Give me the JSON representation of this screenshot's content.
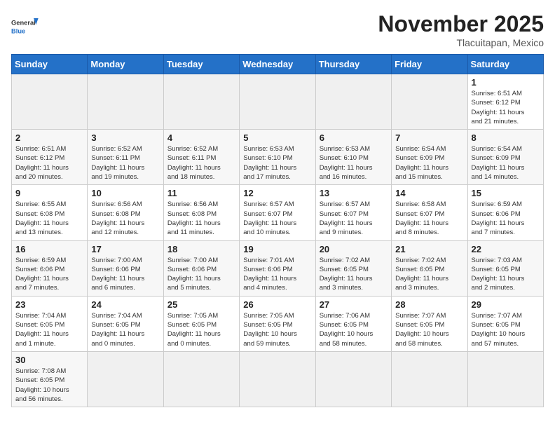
{
  "header": {
    "logo_general": "General",
    "logo_blue": "Blue",
    "month_year": "November 2025",
    "location": "Tlacuitapan, Mexico"
  },
  "weekdays": [
    "Sunday",
    "Monday",
    "Tuesday",
    "Wednesday",
    "Thursday",
    "Friday",
    "Saturday"
  ],
  "weeks": [
    [
      {
        "day": "",
        "info": ""
      },
      {
        "day": "",
        "info": ""
      },
      {
        "day": "",
        "info": ""
      },
      {
        "day": "",
        "info": ""
      },
      {
        "day": "",
        "info": ""
      },
      {
        "day": "",
        "info": ""
      },
      {
        "day": "1",
        "info": "Sunrise: 6:51 AM\nSunset: 6:12 PM\nDaylight: 11 hours\nand 21 minutes."
      }
    ],
    [
      {
        "day": "2",
        "info": "Sunrise: 6:51 AM\nSunset: 6:12 PM\nDaylight: 11 hours\nand 20 minutes."
      },
      {
        "day": "3",
        "info": "Sunrise: 6:52 AM\nSunset: 6:11 PM\nDaylight: 11 hours\nand 19 minutes."
      },
      {
        "day": "4",
        "info": "Sunrise: 6:52 AM\nSunset: 6:11 PM\nDaylight: 11 hours\nand 18 minutes."
      },
      {
        "day": "5",
        "info": "Sunrise: 6:53 AM\nSunset: 6:10 PM\nDaylight: 11 hours\nand 17 minutes."
      },
      {
        "day": "6",
        "info": "Sunrise: 6:53 AM\nSunset: 6:10 PM\nDaylight: 11 hours\nand 16 minutes."
      },
      {
        "day": "7",
        "info": "Sunrise: 6:54 AM\nSunset: 6:09 PM\nDaylight: 11 hours\nand 15 minutes."
      },
      {
        "day": "8",
        "info": "Sunrise: 6:54 AM\nSunset: 6:09 PM\nDaylight: 11 hours\nand 14 minutes."
      }
    ],
    [
      {
        "day": "9",
        "info": "Sunrise: 6:55 AM\nSunset: 6:08 PM\nDaylight: 11 hours\nand 13 minutes."
      },
      {
        "day": "10",
        "info": "Sunrise: 6:56 AM\nSunset: 6:08 PM\nDaylight: 11 hours\nand 12 minutes."
      },
      {
        "day": "11",
        "info": "Sunrise: 6:56 AM\nSunset: 6:08 PM\nDaylight: 11 hours\nand 11 minutes."
      },
      {
        "day": "12",
        "info": "Sunrise: 6:57 AM\nSunset: 6:07 PM\nDaylight: 11 hours\nand 10 minutes."
      },
      {
        "day": "13",
        "info": "Sunrise: 6:57 AM\nSunset: 6:07 PM\nDaylight: 11 hours\nand 9 minutes."
      },
      {
        "day": "14",
        "info": "Sunrise: 6:58 AM\nSunset: 6:07 PM\nDaylight: 11 hours\nand 8 minutes."
      },
      {
        "day": "15",
        "info": "Sunrise: 6:59 AM\nSunset: 6:06 PM\nDaylight: 11 hours\nand 7 minutes."
      }
    ],
    [
      {
        "day": "16",
        "info": "Sunrise: 6:59 AM\nSunset: 6:06 PM\nDaylight: 11 hours\nand 7 minutes."
      },
      {
        "day": "17",
        "info": "Sunrise: 7:00 AM\nSunset: 6:06 PM\nDaylight: 11 hours\nand 6 minutes."
      },
      {
        "day": "18",
        "info": "Sunrise: 7:00 AM\nSunset: 6:06 PM\nDaylight: 11 hours\nand 5 minutes."
      },
      {
        "day": "19",
        "info": "Sunrise: 7:01 AM\nSunset: 6:06 PM\nDaylight: 11 hours\nand 4 minutes."
      },
      {
        "day": "20",
        "info": "Sunrise: 7:02 AM\nSunset: 6:05 PM\nDaylight: 11 hours\nand 3 minutes."
      },
      {
        "day": "21",
        "info": "Sunrise: 7:02 AM\nSunset: 6:05 PM\nDaylight: 11 hours\nand 3 minutes."
      },
      {
        "day": "22",
        "info": "Sunrise: 7:03 AM\nSunset: 6:05 PM\nDaylight: 11 hours\nand 2 minutes."
      }
    ],
    [
      {
        "day": "23",
        "info": "Sunrise: 7:04 AM\nSunset: 6:05 PM\nDaylight: 11 hours\nand 1 minute."
      },
      {
        "day": "24",
        "info": "Sunrise: 7:04 AM\nSunset: 6:05 PM\nDaylight: 11 hours\nand 0 minutes."
      },
      {
        "day": "25",
        "info": "Sunrise: 7:05 AM\nSunset: 6:05 PM\nDaylight: 11 hours\nand 0 minutes."
      },
      {
        "day": "26",
        "info": "Sunrise: 7:05 AM\nSunset: 6:05 PM\nDaylight: 10 hours\nand 59 minutes."
      },
      {
        "day": "27",
        "info": "Sunrise: 7:06 AM\nSunset: 6:05 PM\nDaylight: 10 hours\nand 58 minutes."
      },
      {
        "day": "28",
        "info": "Sunrise: 7:07 AM\nSunset: 6:05 PM\nDaylight: 10 hours\nand 58 minutes."
      },
      {
        "day": "29",
        "info": "Sunrise: 7:07 AM\nSunset: 6:05 PM\nDaylight: 10 hours\nand 57 minutes."
      }
    ],
    [
      {
        "day": "30",
        "info": "Sunrise: 7:08 AM\nSunset: 6:05 PM\nDaylight: 10 hours\nand 56 minutes."
      },
      {
        "day": "",
        "info": ""
      },
      {
        "day": "",
        "info": ""
      },
      {
        "day": "",
        "info": ""
      },
      {
        "day": "",
        "info": ""
      },
      {
        "day": "",
        "info": ""
      },
      {
        "day": "",
        "info": ""
      }
    ]
  ]
}
